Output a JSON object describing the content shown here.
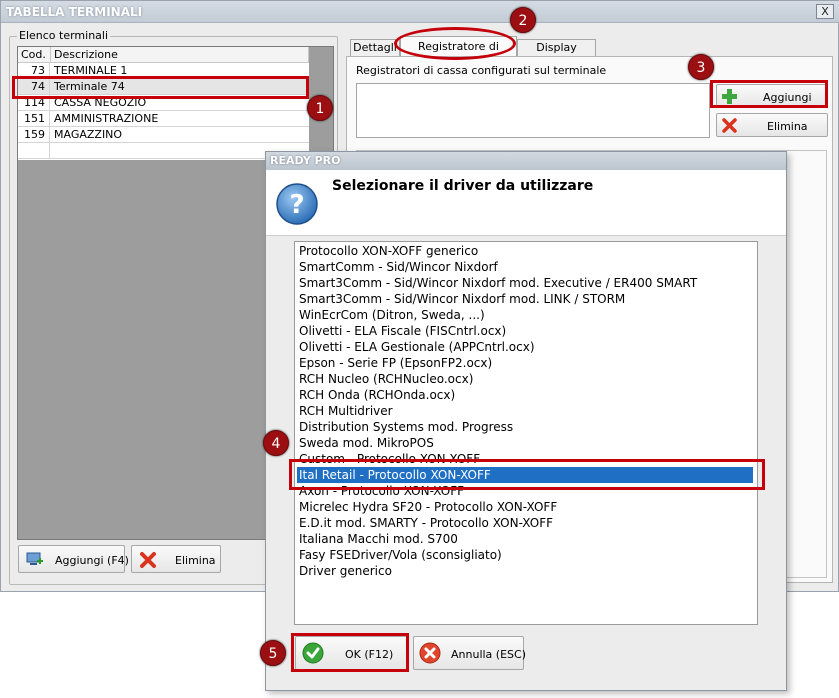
{
  "window": {
    "title": "TABELLA TERMINALI",
    "close_label": "X"
  },
  "left_panel": {
    "group_label": "Elenco terminali",
    "columns": [
      "Cod.",
      "Descrizione"
    ],
    "rows": [
      {
        "code": "73",
        "desc": "TERMINALE 1"
      },
      {
        "code": "74",
        "desc": "Terminale 74"
      },
      {
        "code": "114",
        "desc": "CASSA NEGOZIO"
      },
      {
        "code": "151",
        "desc": "AMMINISTRAZIONE"
      },
      {
        "code": "159",
        "desc": "MAGAZZINO"
      }
    ],
    "add_label": "Aggiungi (F4)",
    "delete_label": "Elimina"
  },
  "tabs": [
    "Dettagli",
    "Registratore di cassa",
    "Display cliente"
  ],
  "register_panel": {
    "label": "Registratori di cassa configurati sul terminale",
    "add_label": "Aggiungi",
    "delete_label": "Elimina"
  },
  "dialog": {
    "title": "READY PRO",
    "heading": "Selezionare il driver da utilizzare",
    "drivers": [
      "Protocollo XON-XOFF generico",
      "SmartComm - Sid/Wincor Nixdorf",
      "Smart3Comm - Sid/Wincor Nixdorf mod. Executive / ER400 SMART",
      "Smart3Comm - Sid/Wincor Nixdorf mod. LINK / STORM",
      "WinEcrCom (Ditron, Sweda, ...)",
      "Olivetti - ELA Fiscale (FISCntrl.ocx)",
      "Olivetti - ELA Gestionale (APPCntrl.ocx)",
      "Epson - Serie FP (EpsonFP2.ocx)",
      "RCH Nucleo (RCHNucleo.ocx)",
      "RCH Onda (RCHOnda.ocx)",
      "RCH Multidriver",
      "Distribution Systems mod. Progress",
      "Sweda mod. MikroPOS",
      "Custom - Protocollo XON-XOFF",
      "Ital Retail - Protocollo XON-XOFF",
      "Axon - Protocollo XON-XOFF",
      "Micrelec Hydra SF20 - Protocollo XON-XOFF",
      "E.D.it mod. SMARTY - Protocollo XON-XOFF",
      "Italiana Macchi mod. S700",
      "Fasy FSEDriver/Vola (sconsigliato)",
      "Driver generico"
    ],
    "selected_index": 14,
    "ok_label": "OK (F12)",
    "cancel_label": "Annulla (ESC)"
  },
  "annotations": [
    "1",
    "2",
    "3",
    "4",
    "5"
  ],
  "colors": {
    "annotation_red": "#c5000b",
    "selection_blue": "#1f6fc4"
  }
}
